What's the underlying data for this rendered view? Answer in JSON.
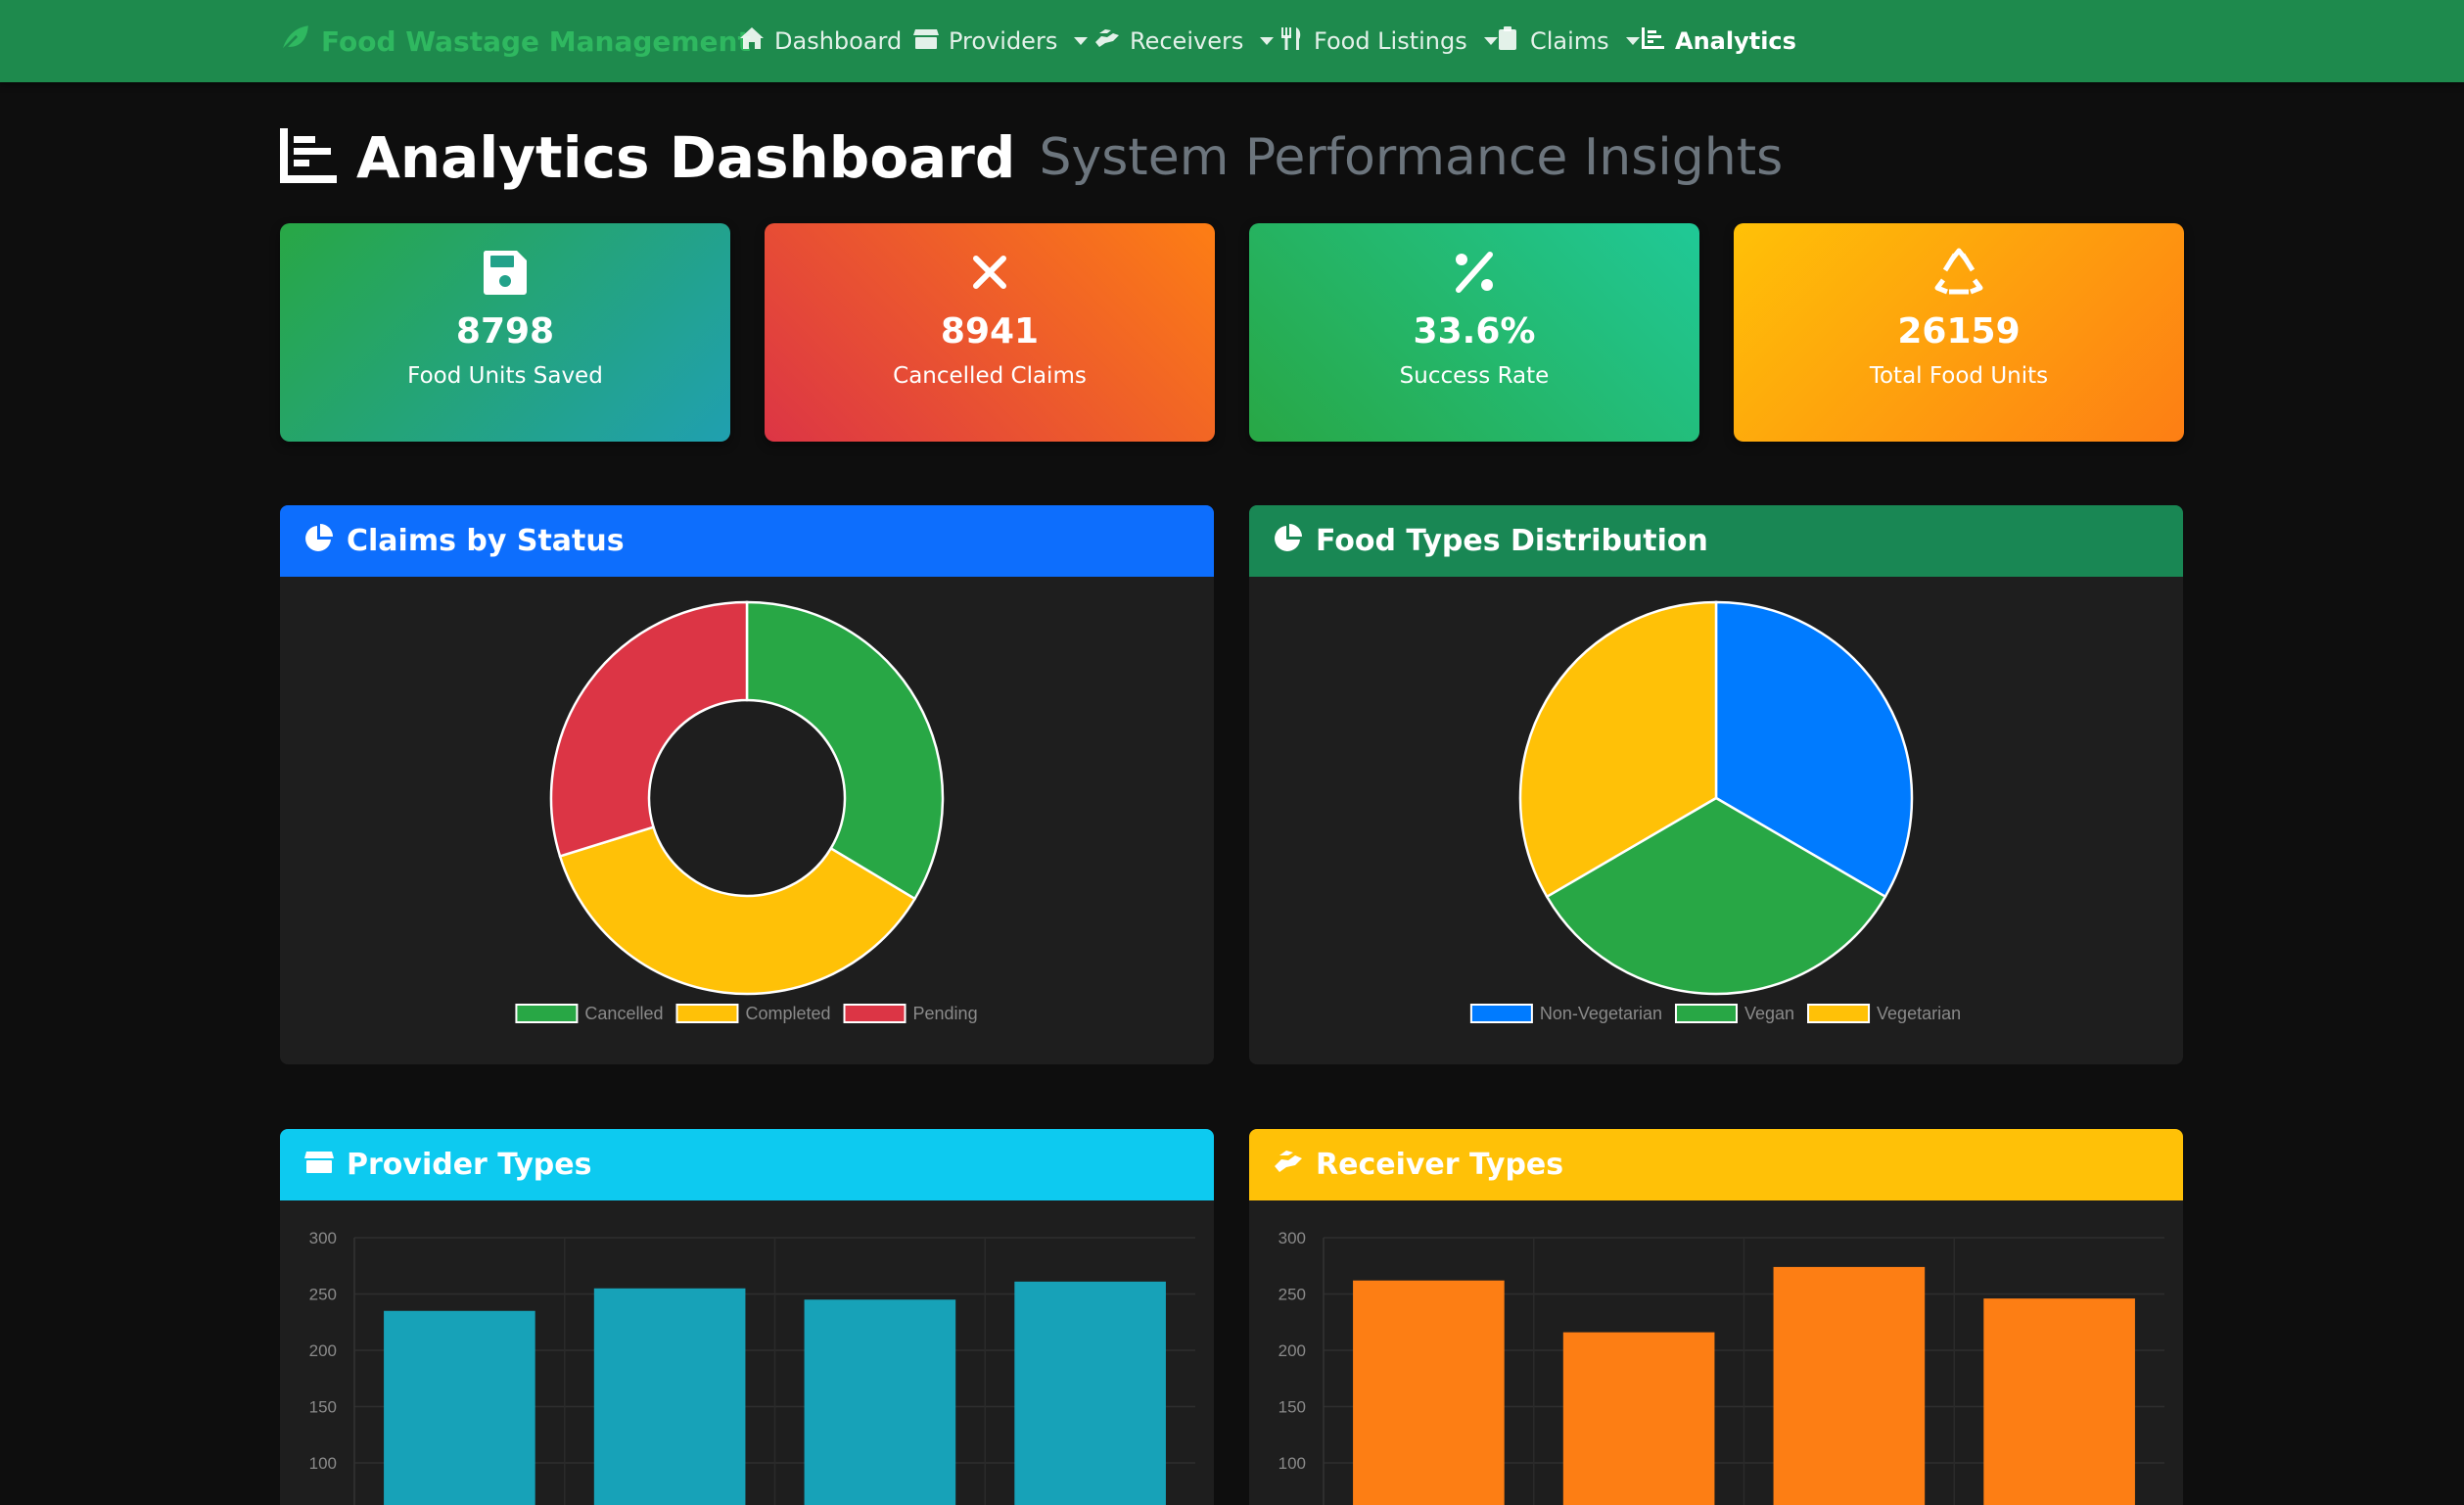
{
  "navbar": {
    "brand": "Food Wastage Management",
    "items": [
      {
        "label": "Dashboard",
        "icon": "home-icon",
        "dropdown": false,
        "active": false
      },
      {
        "label": "Providers",
        "icon": "store-icon",
        "dropdown": true,
        "active": false
      },
      {
        "label": "Receivers",
        "icon": "hands-icon",
        "dropdown": true,
        "active": false
      },
      {
        "label": "Food Listings",
        "icon": "utensils-icon",
        "dropdown": true,
        "active": false
      },
      {
        "label": "Claims",
        "icon": "clipboard-icon",
        "dropdown": true,
        "active": false
      },
      {
        "label": "Analytics",
        "icon": "chart-bar-icon",
        "dropdown": false,
        "active": true
      }
    ]
  },
  "page": {
    "title": "Analytics Dashboard",
    "subtitle": "System Performance Insights"
  },
  "stats": [
    {
      "value": "8798",
      "label": "Food Units Saved",
      "icon": "save-icon"
    },
    {
      "value": "8941",
      "label": "Cancelled Claims",
      "icon": "times-icon"
    },
    {
      "value": "33.6%",
      "label": "Success Rate",
      "icon": "percent-icon"
    },
    {
      "value": "26159",
      "label": "Total Food Units",
      "icon": "recycle-icon"
    }
  ],
  "colors": {
    "green": "#28a745",
    "yellow": "#ffc107",
    "red": "#dc3545",
    "blue": "#007bff",
    "teal": "#17a2b8",
    "orange": "#fd7e14"
  },
  "charts": {
    "status": {
      "title": "Claims by Status"
    },
    "food": {
      "title": "Food Types Distribution"
    },
    "provider": {
      "title": "Provider Types"
    },
    "receiver": {
      "title": "Receiver Types"
    }
  },
  "chart_data": [
    {
      "type": "pie",
      "variant": "doughnut",
      "title": "Claims by Status",
      "categories": [
        "Cancelled",
        "Completed",
        "Pending"
      ],
      "values": [
        33.6,
        36.6,
        29.8
      ],
      "colors": [
        "#28a745",
        "#ffc107",
        "#dc3545"
      ],
      "legend": "bottom"
    },
    {
      "type": "pie",
      "title": "Food Types Distribution",
      "categories": [
        "Non-Vegetarian",
        "Vegan",
        "Vegetarian"
      ],
      "values": [
        33.4,
        33.2,
        33.4
      ],
      "colors": [
        "#007bff",
        "#28a745",
        "#ffc107"
      ],
      "legend": "bottom"
    },
    {
      "type": "bar",
      "title": "Provider Types",
      "categories": [
        "",
        "",
        "",
        ""
      ],
      "values": [
        235,
        255,
        245,
        261
      ],
      "color": "#17a2b8",
      "yticks": [
        100,
        150,
        200,
        250,
        300
      ],
      "ylim": [
        0,
        300
      ],
      "grid": true
    },
    {
      "type": "bar",
      "title": "Receiver Types",
      "categories": [
        "",
        "",
        "",
        ""
      ],
      "values": [
        262,
        216,
        274,
        246
      ],
      "color": "#fd7e14",
      "yticks": [
        100,
        150,
        200,
        250,
        300
      ],
      "ylim": [
        0,
        300
      ],
      "grid": true
    }
  ]
}
